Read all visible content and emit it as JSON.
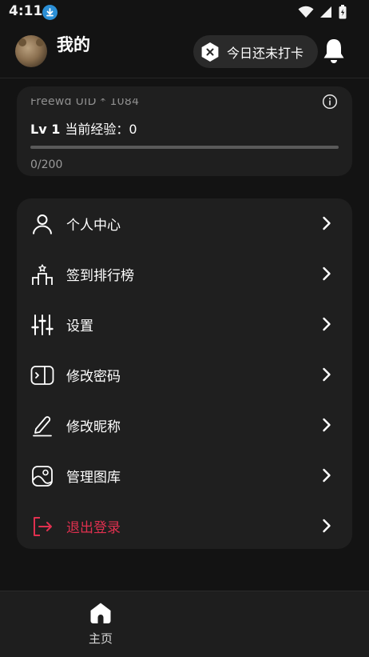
{
  "status_bar": {
    "time": "4:11"
  },
  "header": {
    "user_name": "我的",
    "checkin_label": "今日还未打卡"
  },
  "level_card": {
    "uid_text": "Freewd UID * 1084",
    "level": "Lv 1",
    "exp_label": "当前经验：0",
    "progress_text": "0/200",
    "progress_fraction": 0.0
  },
  "menu": {
    "items": [
      {
        "label": "个人中心",
        "icon": "person-icon"
      },
      {
        "label": "签到排行榜",
        "icon": "ranking-podium-icon"
      },
      {
        "label": "设置",
        "icon": "sliders-icon"
      },
      {
        "label": "修改密码",
        "icon": "password-icon"
      },
      {
        "label": "修改昵称",
        "icon": "pencil-icon"
      },
      {
        "label": "管理图库",
        "icon": "image-gallery-icon"
      },
      {
        "label": "退出登录",
        "icon": "logout-icon"
      }
    ]
  },
  "bottom_nav": {
    "home_label": "主页"
  },
  "colors": {
    "accent_danger": "#e0304f",
    "card_bg": "#1f1f1f",
    "page_bg": "#131313"
  }
}
